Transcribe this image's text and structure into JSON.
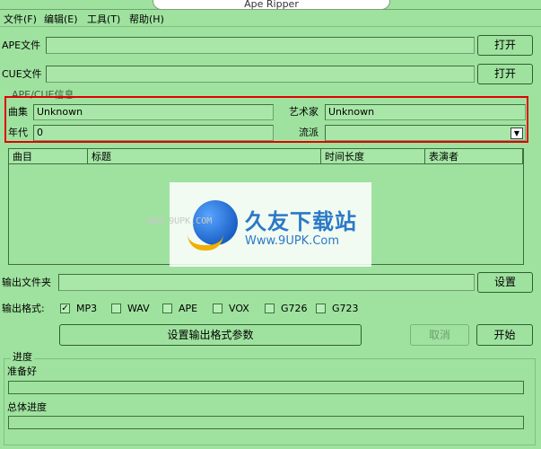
{
  "window": {
    "title": "Ape Ripper"
  },
  "menu": [
    "文件(F)",
    "编辑(E)",
    "工具(T)",
    "帮助(H)"
  ],
  "ape_file": {
    "label": "APE文件",
    "value": "",
    "button": "打开"
  },
  "cue_file": {
    "label": "CUE文件",
    "value": "",
    "button": "打开"
  },
  "info_group": {
    "title": "APE/CUE信息",
    "album_label": "曲集",
    "album_value": "Unknown",
    "artist_label": "艺术家",
    "artist_value": "Unknown",
    "year_label": "年代",
    "year_value": "0",
    "genre_label": "流派",
    "genre_value": ""
  },
  "track_list": {
    "columns": [
      "曲目",
      "标题",
      "时间长度",
      "表演者"
    ],
    "rows": []
  },
  "watermark": {
    "title": "久友下载站",
    "url": "Www.9UPK.Com",
    "small": "WWW.9UPK.COM"
  },
  "output": {
    "label": "输出文件夹",
    "value": "",
    "button": "设置"
  },
  "formats": {
    "label": "输出格式:",
    "items": [
      {
        "name": "MP3",
        "checked": true
      },
      {
        "name": "WAV",
        "checked": false
      },
      {
        "name": "APE",
        "checked": false
      },
      {
        "name": "VOX",
        "checked": false
      },
      {
        "name": "G726",
        "checked": false
      },
      {
        "name": "G723",
        "checked": false
      }
    ]
  },
  "actions": {
    "settings": "设置输出格式参数",
    "cancel": "取消",
    "start": "开始"
  },
  "progress": {
    "group_title": "进度",
    "status": "准备好",
    "status_value": 0,
    "total_label": "总体进度",
    "total_value": 0
  },
  "colors": {
    "background": "#9fe29f",
    "highlight": "#e00000",
    "accent": "#2b79c8"
  }
}
